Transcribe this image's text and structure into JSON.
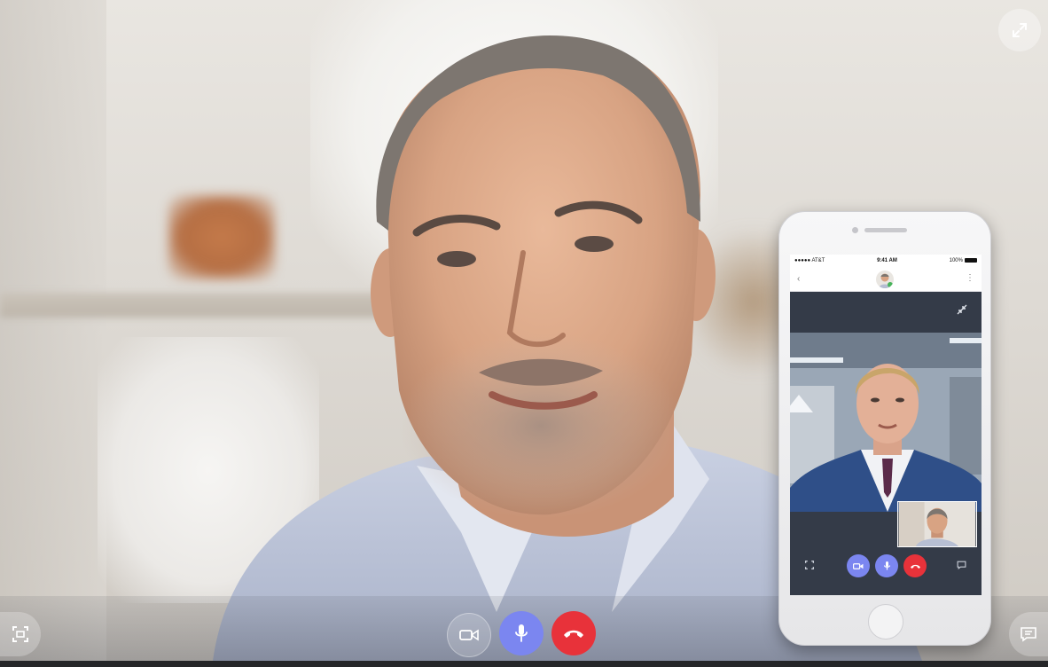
{
  "call": {
    "expand_icon": "expand-arrows-icon",
    "controls": {
      "screen_share_icon": "screen-capture-icon",
      "video_icon": "video-camera-icon",
      "mic_icon": "microphone-icon",
      "hangup_icon": "phone-hangup-icon",
      "chat_icon": "chat-bubble-icon"
    },
    "colors": {
      "mic_active": "#7b86f0",
      "hangup": "#e8323a",
      "phone_call_bg": "#343b48"
    }
  },
  "phone": {
    "status_bar": {
      "carrier": "●●●●● AT&T",
      "time": "9:41 AM",
      "battery": "100%"
    },
    "header": {
      "back_icon": "chevron-left-icon",
      "more_icon": "more-vertical-icon"
    },
    "controls": {
      "screen_share_icon": "screen-capture-icon",
      "video_icon": "video-camera-icon",
      "mic_icon": "microphone-icon",
      "hangup_icon": "phone-hangup-icon",
      "chat_icon": "chat-bubble-icon"
    }
  }
}
